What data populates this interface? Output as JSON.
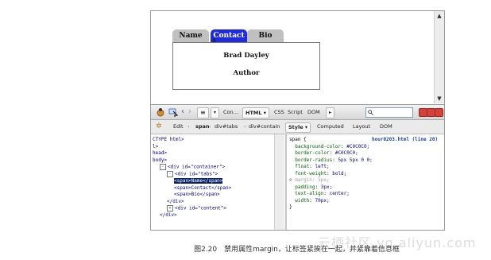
{
  "page": {
    "tabs": [
      "Name",
      "Contact",
      "Bio"
    ],
    "active_tab": "Contact",
    "content_lines": [
      "Brad Dayley",
      "Author"
    ]
  },
  "firebug": {
    "toolbar": {
      "console": "Con...",
      "html": "HTML",
      "css": "CSS",
      "script": "Script",
      "dom": "DOM"
    },
    "breadcrumb": {
      "edit": "Edit",
      "items": [
        "span",
        "div#tabs",
        "div#contain"
      ]
    },
    "side_tabs": [
      "Style",
      "Computed",
      "Layout",
      "DOM"
    ],
    "html_tree": [
      {
        "indent": 0,
        "text": "CTYPE html>",
        "toggle": ""
      },
      {
        "indent": 0,
        "text": "l>",
        "toggle": ""
      },
      {
        "indent": 0,
        "text": "head>",
        "toggle": ""
      },
      {
        "indent": 0,
        "text": "body>",
        "toggle": ""
      },
      {
        "indent": 1,
        "text": "<div id=\"container\">",
        "toggle": "-"
      },
      {
        "indent": 2,
        "text": "<div id=\"tabs\">",
        "toggle": "-"
      },
      {
        "indent": 3,
        "text": "<span>Name</span>",
        "toggle": "",
        "selected": true
      },
      {
        "indent": 3,
        "text": "<span>Contact</span>",
        "toggle": ""
      },
      {
        "indent": 3,
        "text": "<span>Bio</span>",
        "toggle": ""
      },
      {
        "indent": 2,
        "text": "</div>",
        "toggle": ""
      },
      {
        "indent": 2,
        "text": "<div id=\"content\">",
        "toggle": "+"
      },
      {
        "indent": 1,
        "text": "</div>",
        "toggle": ""
      }
    ],
    "css_source": "hour0203.html (line 20)",
    "css_rule": {
      "selector": "span {",
      "props": [
        {
          "name": "background-color",
          "value": "#C0C0C0;",
          "disabled": false
        },
        {
          "name": "border-color",
          "value": "#C0C0C0;",
          "disabled": false
        },
        {
          "name": "border-radius",
          "value": "5px 5px 0 0;",
          "disabled": false
        },
        {
          "name": "float",
          "value": "left;",
          "disabled": false
        },
        {
          "name": "font-weight",
          "value": "bold;",
          "disabled": false
        },
        {
          "name": "margin",
          "value": "5px;",
          "disabled": true
        },
        {
          "name": "padding",
          "value": "3px;",
          "disabled": false
        },
        {
          "name": "text-align",
          "value": "center;",
          "disabled": false
        },
        {
          "name": "width",
          "value": "70px;",
          "disabled": false
        }
      ],
      "close": "}"
    }
  },
  "caption": "图2.20　禁用属性margin，让标签紧挨在一起，并紧靠着信息框",
  "watermark": "云栖社区 yq.aliyun.com",
  "colors": {
    "active_tab": "#1F2BE0",
    "tab": "#C0C0C0",
    "selection": "#0A246A"
  }
}
